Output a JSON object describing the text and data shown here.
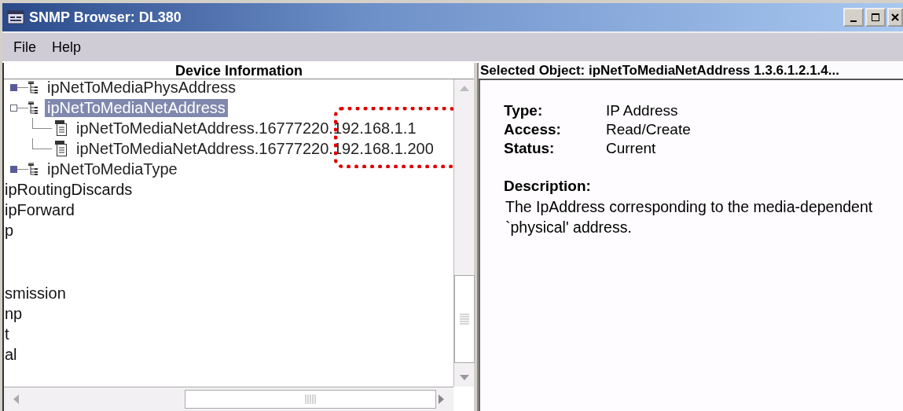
{
  "window": {
    "title": "SNMP Browser: DL380"
  },
  "menu": [
    "File",
    "Help"
  ],
  "left_pane": {
    "title": "Device Information"
  },
  "tree": {
    "branch": [
      {
        "label": "ipNetToMediaPhysAddress",
        "expanded": false,
        "selected": false
      },
      {
        "label": "ipNetToMediaNetAddress",
        "expanded": true,
        "selected": true,
        "children": [
          {
            "label": "ipNetToMediaNetAddress.16777220.192.168.1.1",
            "selected": false
          },
          {
            "label": "ipNetToMediaNetAddress.16777220.192.168.1.200",
            "selected": false
          }
        ]
      },
      {
        "label": "ipNetToMediaType",
        "expanded": false,
        "selected": false
      }
    ],
    "outer_items_top": [
      "ipRoutingDiscards",
      "ipForward",
      "p"
    ],
    "outer_items_bottom": [
      "smission",
      "np",
      "t",
      "al"
    ]
  },
  "right_pane": {
    "title": "Selected Object:  ipNetToMediaNetAddress  1.3.6.1.2.1.4...",
    "properties": [
      {
        "label": "Type:",
        "value": "IP Address"
      },
      {
        "label": "Access:",
        "value": "Read/Create"
      },
      {
        "label": "Status:",
        "value": "Current"
      }
    ],
    "description_label": "Description:",
    "description": "The IpAddress corresponding to the media-dependent `physical' address."
  }
}
